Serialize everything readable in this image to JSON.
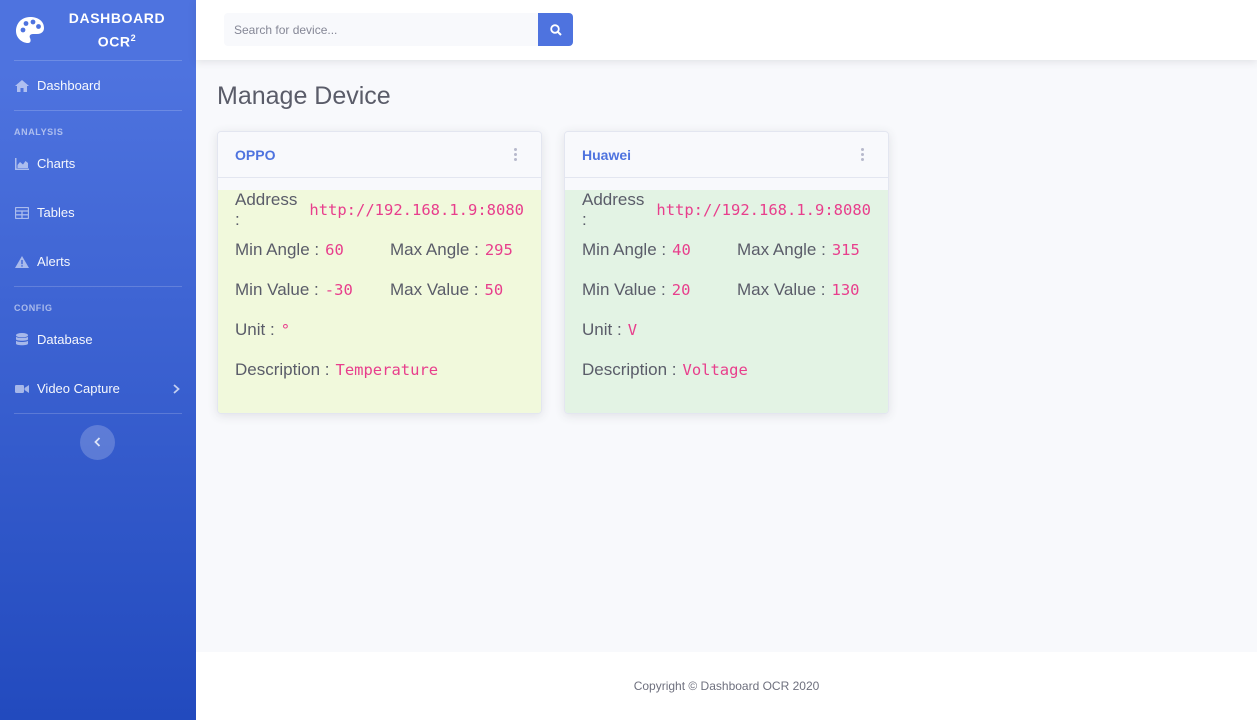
{
  "brand": {
    "line1": "DASHBOARD",
    "line2": "OCR",
    "sup": "2"
  },
  "nav": {
    "dashboard": "Dashboard",
    "analysis_heading": "ANALYSIS",
    "charts": "Charts",
    "tables": "Tables",
    "alerts": "Alerts",
    "config_heading": "CONFIG",
    "database": "Database",
    "video_capture": "Video Capture"
  },
  "search": {
    "placeholder": "Search for device..."
  },
  "page": {
    "title": "Manage Device"
  },
  "labels": {
    "address": "Address :",
    "min_angle": "Min Angle :",
    "max_angle": "Max Angle :",
    "min_value": "Min Value :",
    "max_value": "Max Value :",
    "unit": "Unit :",
    "description": "Description :"
  },
  "devices": [
    {
      "name": "OPPO",
      "address": "http://192.168.1.9:8080",
      "min_angle": "60",
      "max_angle": "295",
      "min_value": "-30",
      "max_value": "50",
      "unit": "°",
      "description": "Temperature",
      "bg": "#f1f9dc"
    },
    {
      "name": "Huawei",
      "address": "http://192.168.1.9:8080",
      "min_angle": "40",
      "max_angle": "315",
      "min_value": "20",
      "max_value": "130",
      "unit": "V",
      "description": "Voltage",
      "bg": "#e3f3e4"
    }
  ],
  "footer": {
    "text": "Copyright © Dashboard OCR 2020"
  },
  "colors": {
    "primary": "#4e73df",
    "code": "#e83e8c"
  }
}
